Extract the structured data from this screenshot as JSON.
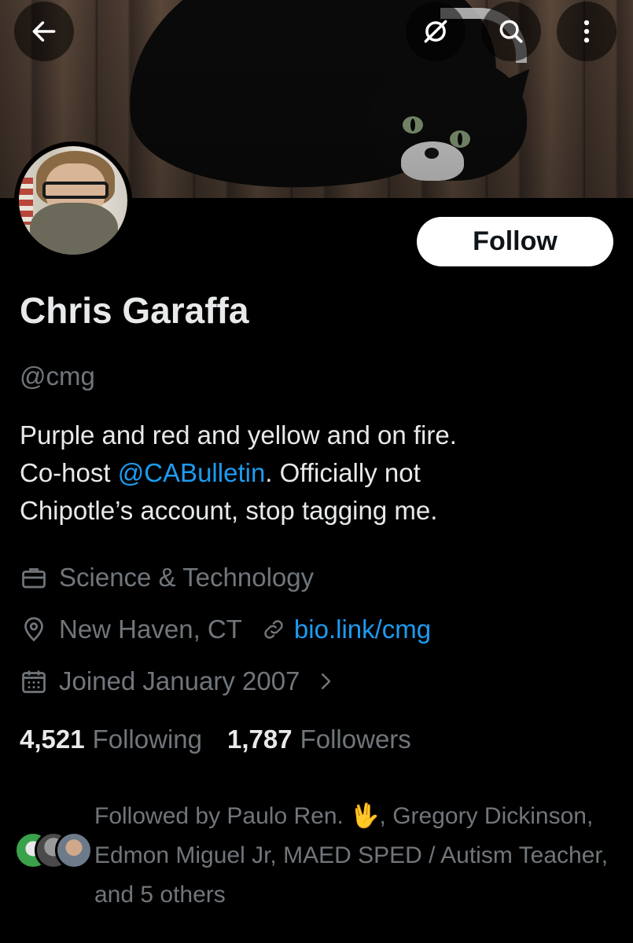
{
  "header": {
    "back_icon": "back-arrow-icon",
    "grok_icon": "grok-icon",
    "search_icon": "search-icon",
    "more_icon": "more-vertical-icon"
  },
  "profile": {
    "follow_label": "Follow",
    "name": "Chris Garaffa",
    "handle": "@cmg",
    "bio_line1": "Purple and red and yellow and on fire.",
    "bio_line2_pre": "Co-host ",
    "bio_mention": "@CABulletin",
    "bio_line2_post": ". Officially not",
    "bio_line3": "Chipotle’s account, stop tagging me.",
    "category": "Science & Technology",
    "location": "New Haven, CT",
    "website": "bio.link/cmg",
    "joined": "Joined January 2007"
  },
  "stats": {
    "following_count": "4,521",
    "following_label": "Following",
    "followers_count": "1,787",
    "followers_label": "Followers"
  },
  "followed_by": {
    "part1": "Followed by Paulo Ren. ",
    "emoji": "🖖",
    "part2": ", Gregory Dickinson, Edmon Miguel Jr, MAED SPED / Autism Teacher, and 5 others"
  },
  "colors": {
    "background": "#000000",
    "text": "#e7e9ea",
    "secondary": "#71767b",
    "link": "#1d9bf0"
  }
}
